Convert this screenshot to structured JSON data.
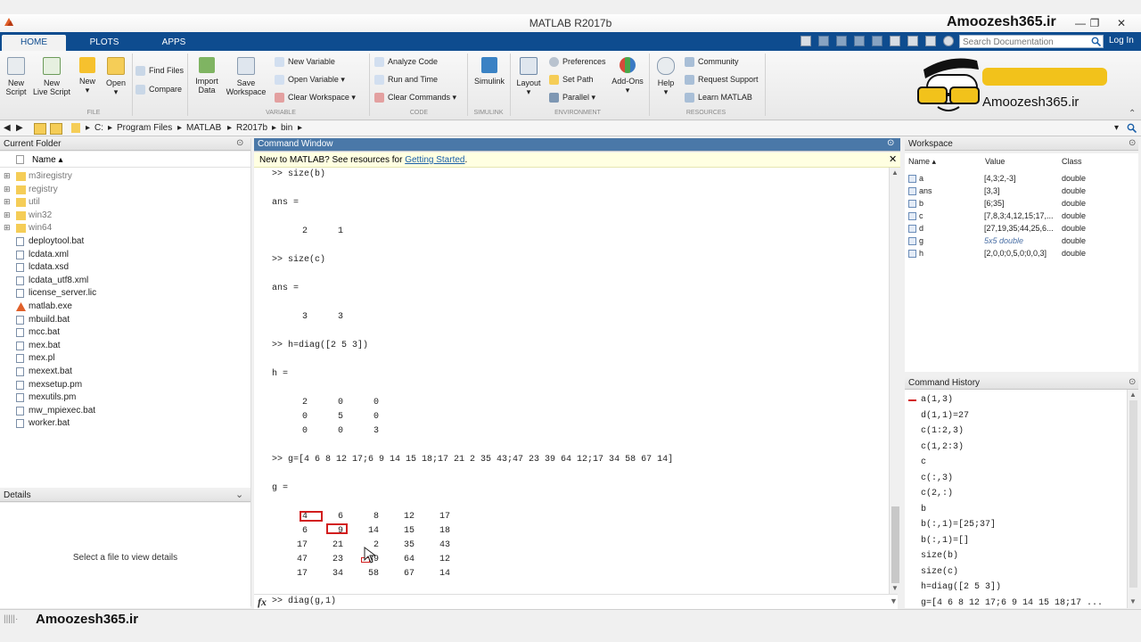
{
  "window": {
    "title": "MATLAB R2017b",
    "watermark": "Amoozesh365.ir",
    "minimize": "—",
    "restore": "❐",
    "close": "✕"
  },
  "tabs": [
    {
      "label": "HOME",
      "active": true
    },
    {
      "label": "PLOTS",
      "active": false
    },
    {
      "label": "APPS",
      "active": false
    }
  ],
  "search": {
    "placeholder": "Search Documentation"
  },
  "login": "Log In",
  "ribbon": {
    "new_script": "New\nScript",
    "new_live_script": "New\nLive Script",
    "new": "New",
    "open": "Open",
    "find_files": "Find Files",
    "compare": "Compare",
    "import_data": "Import\nData",
    "save_workspace": "Save\nWorkspace",
    "new_variable": "New Variable",
    "open_variable": "Open Variable",
    "clear_workspace": "Clear Workspace",
    "analyze_code": "Analyze Code",
    "run_and_time": "Run and Time",
    "clear_commands": "Clear Commands",
    "simulink": "Simulink",
    "layout": "Layout",
    "preferences": "Preferences",
    "set_path": "Set Path",
    "parallel": "Parallel",
    "add_ons": "Add-Ons",
    "help": "Help",
    "community": "Community",
    "request_support": "Request Support",
    "learn_matlab": "Learn MATLAB",
    "sections": [
      "FILE",
      "VARIABLE",
      "CODE",
      "SIMULINK",
      "ENVIRONMENT",
      "RESOURCES"
    ],
    "logo_text": "Amoozesh365.ir"
  },
  "address": {
    "path": [
      "C:",
      "Program Files",
      "MATLAB",
      "R2017b",
      "bin"
    ]
  },
  "current_folder": {
    "title": "Current Folder",
    "column": "Name ▴",
    "items": [
      {
        "name": "m3iregistry",
        "type": "folder"
      },
      {
        "name": "registry",
        "type": "folder"
      },
      {
        "name": "util",
        "type": "folder"
      },
      {
        "name": "win32",
        "type": "folder"
      },
      {
        "name": "win64",
        "type": "folder"
      },
      {
        "name": "deploytool.bat",
        "type": "file"
      },
      {
        "name": "lcdata.xml",
        "type": "file"
      },
      {
        "name": "lcdata.xsd",
        "type": "file"
      },
      {
        "name": "lcdata_utf8.xml",
        "type": "file"
      },
      {
        "name": "license_server.lic",
        "type": "file"
      },
      {
        "name": "matlab.exe",
        "type": "exe"
      },
      {
        "name": "mbuild.bat",
        "type": "file"
      },
      {
        "name": "mcc.bat",
        "type": "file"
      },
      {
        "name": "mex.bat",
        "type": "file"
      },
      {
        "name": "mex.pl",
        "type": "file"
      },
      {
        "name": "mexext.bat",
        "type": "file"
      },
      {
        "name": "mexsetup.pm",
        "type": "file"
      },
      {
        "name": "mexutils.pm",
        "type": "file"
      },
      {
        "name": "mw_mpiexec.bat",
        "type": "file"
      },
      {
        "name": "worker.bat",
        "type": "file"
      }
    ]
  },
  "details": {
    "title": "Details",
    "empty": "Select a file to view details"
  },
  "command_window": {
    "title": "Command Window",
    "banner_prefix": "New to MATLAB? See resources for ",
    "banner_link": "Getting Started",
    "banner_suffix": ".",
    "lines": [
      ">> size(b)",
      "ans =",
      ">> size(c)",
      "ans =",
      ">> h=diag([2 5 3])",
      "h =",
      ">> g=[4 6 8 12 17;6 9 14 15 18;17 21 2 35 43;47 23 39 64 12;17 34 58 67 14]",
      "g ="
    ],
    "size_b": [
      "2",
      "1"
    ],
    "size_c": [
      "3",
      "3"
    ],
    "h_matrix": [
      [
        "2",
        "0",
        "0"
      ],
      [
        "0",
        "5",
        "0"
      ],
      [
        "0",
        "0",
        "3"
      ]
    ],
    "g_matrix": [
      [
        "4",
        "6",
        "8",
        "12",
        "17"
      ],
      [
        "6",
        "9",
        "14",
        "15",
        "18"
      ],
      [
        "17",
        "21",
        "2",
        "35",
        "43"
      ],
      [
        "47",
        "23",
        "39",
        "64",
        "12"
      ],
      [
        "17",
        "34",
        "58",
        "67",
        "14"
      ]
    ],
    "current_input": ">> diag(g,1)",
    "fx": "fx"
  },
  "workspace": {
    "title": "Workspace",
    "headers": [
      "Name ▴",
      "Value",
      "Class"
    ],
    "rows": [
      {
        "name": "a",
        "value": "[4,3;2,-3]",
        "class": "double"
      },
      {
        "name": "ans",
        "value": "[3,3]",
        "class": "double"
      },
      {
        "name": "b",
        "value": "[6;35]",
        "class": "double"
      },
      {
        "name": "c",
        "value": "[7,8,3;4,12,15;17,...",
        "class": "double"
      },
      {
        "name": "d",
        "value": "[27,19,35;44,25,6...",
        "class": "double"
      },
      {
        "name": "g",
        "value": "5x5 double",
        "class": "double"
      },
      {
        "name": "h",
        "value": "[2,0,0;0,5,0;0,0,3]",
        "class": "double"
      }
    ]
  },
  "history": {
    "title": "Command History",
    "items": [
      "a(1,3)",
      "d(1,1)=27",
      "c(1:2,3)",
      "c(1,2:3)",
      "c",
      "c(:,3)",
      "c(2,:)",
      "b",
      "b(:,1)=[25;37]",
      "b(:,1)=[]",
      "size(b)",
      "size(c)",
      "h=diag([2 5 3])",
      "g=[4 6 8 12 17;6 9 14 15 18;17 ..."
    ]
  },
  "status": {
    "brand": "Amoozesh365.ir"
  },
  "colors": {
    "tab_bar": "#0e4c8f",
    "panel_active": "#4a78a8",
    "highlight": "#d21e1e"
  }
}
